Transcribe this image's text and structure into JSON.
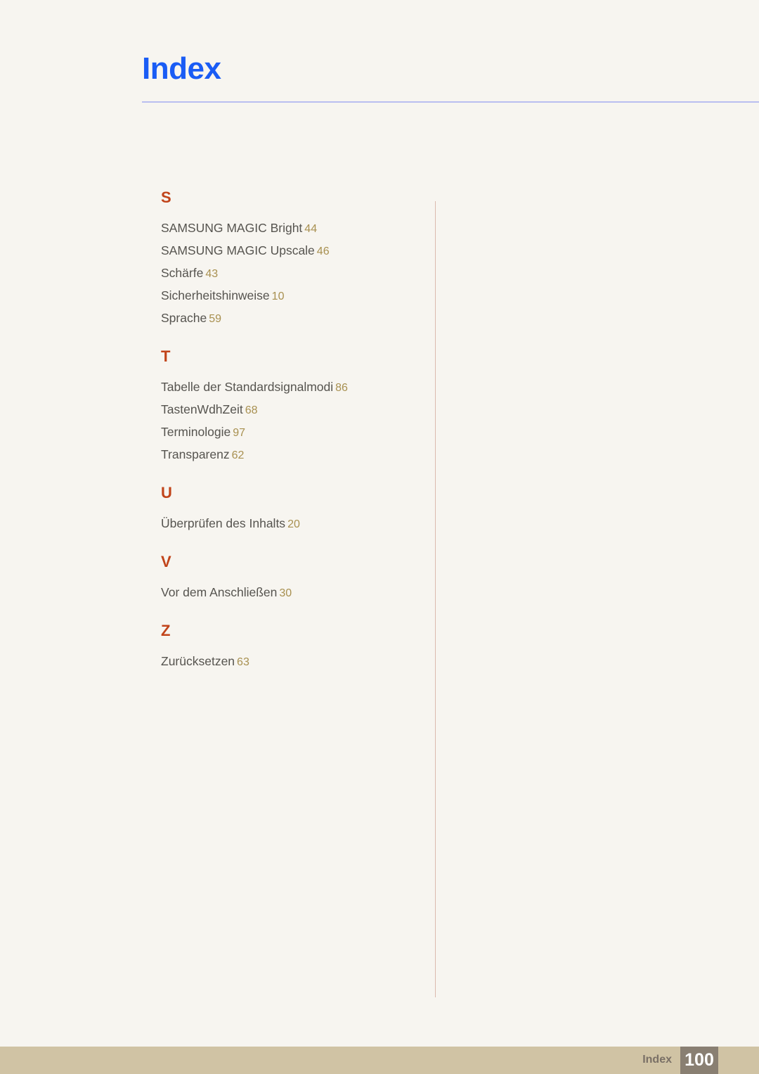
{
  "header": {
    "title": "Index"
  },
  "colors": {
    "page_background": "#f7f5f0",
    "title": "#1a5cf5",
    "header_rule": "#b9bef0",
    "section_letter": "#c1441a",
    "entry_text": "#56544f",
    "entry_page_number": "#a89050",
    "column_divider": "#dbb9ae",
    "footer_band": "#d0c3a4",
    "footer_label": "#7a7066",
    "footer_page_box": "#897f72",
    "footer_page_number": "#ffffff"
  },
  "index": {
    "sections": [
      {
        "letter": "S",
        "entries": [
          {
            "label": "SAMSUNG MAGIC Bright",
            "page": "44"
          },
          {
            "label": "SAMSUNG MAGIC Upscale",
            "page": "46"
          },
          {
            "label": "Schärfe",
            "page": "43"
          },
          {
            "label": "Sicherheitshinweise",
            "page": "10"
          },
          {
            "label": "Sprache",
            "page": "59"
          }
        ]
      },
      {
        "letter": "T",
        "entries": [
          {
            "label": "Tabelle der Standardsignalmodi",
            "page": "86"
          },
          {
            "label": "TastenWdhZeit",
            "page": "68"
          },
          {
            "label": "Terminologie",
            "page": "97"
          },
          {
            "label": "Transparenz",
            "page": "62"
          }
        ]
      },
      {
        "letter": "U",
        "entries": [
          {
            "label": "Überprüfen des Inhalts",
            "page": "20"
          }
        ]
      },
      {
        "letter": "V",
        "entries": [
          {
            "label": "Vor dem Anschließen",
            "page": "30"
          }
        ]
      },
      {
        "letter": "Z",
        "entries": [
          {
            "label": "Zurücksetzen",
            "page": "63"
          }
        ]
      }
    ]
  },
  "footer": {
    "label": "Index",
    "page_number": "100"
  }
}
